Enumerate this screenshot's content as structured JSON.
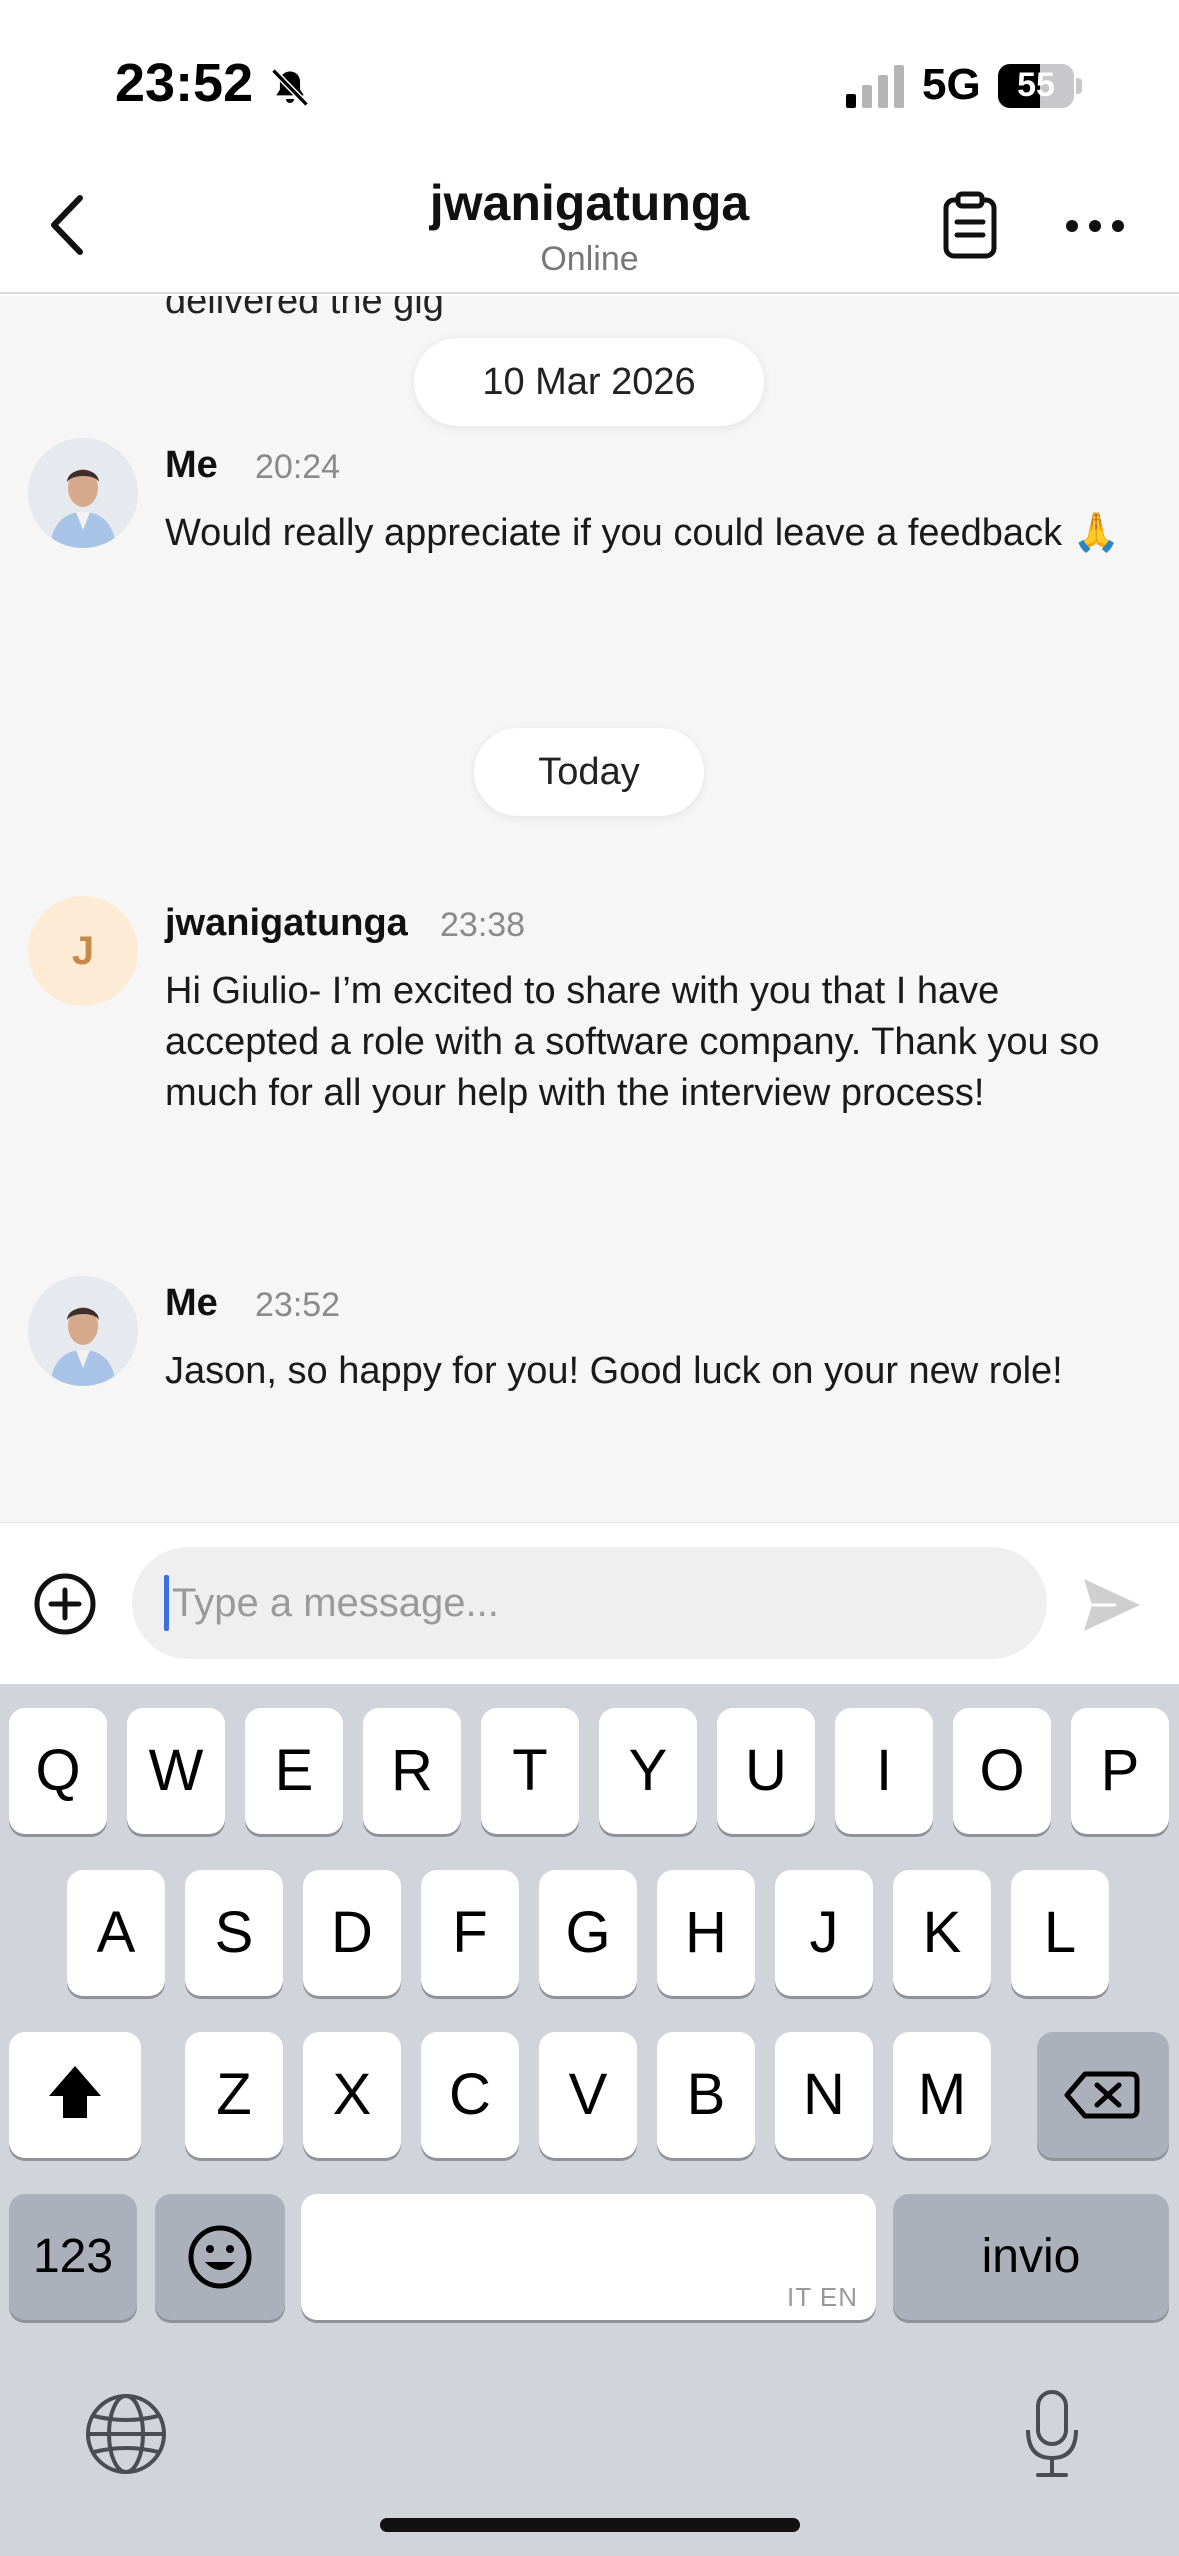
{
  "status_bar": {
    "time": "23:52",
    "network": "5G",
    "battery": "55",
    "battery_level": 0.55,
    "icons": [
      "bell-slash-icon",
      "signal-icon",
      "battery-icon"
    ]
  },
  "header": {
    "title": "jwanigatunga",
    "subtitle": "Online",
    "icons": [
      "back-chevron-icon",
      "clipboard-icon",
      "more-icon"
    ]
  },
  "chat": {
    "clipped_text": "delivered the gig",
    "dates": [
      "10 Mar 2026",
      "Today"
    ],
    "messages": [
      {
        "sender": "Me",
        "time": "20:24",
        "text": "Would really appreciate if you could leave a feedback 🙏",
        "avatar": "photo"
      },
      {
        "sender": "jwanigatunga",
        "time": "23:38",
        "text": "Hi Giulio- I’m excited to share with you that I have accepted a role with a software company. Thank you so much for all your help with the interview process!",
        "avatar": "J"
      },
      {
        "sender": "Me",
        "time": "23:52",
        "text": "Jason, so happy for you! Good luck on your new role!",
        "avatar": "photo"
      }
    ]
  },
  "composer": {
    "placeholder": "Type a message...",
    "value": "",
    "icons": [
      "plus-circle-icon",
      "send-icon"
    ]
  },
  "keyboard": {
    "row1": [
      "Q",
      "W",
      "E",
      "R",
      "T",
      "Y",
      "U",
      "I",
      "O",
      "P"
    ],
    "row2": [
      "A",
      "S",
      "D",
      "F",
      "G",
      "H",
      "J",
      "K",
      "L"
    ],
    "row3": [
      "Z",
      "X",
      "C",
      "V",
      "B",
      "N",
      "M"
    ],
    "numbers_label": "123",
    "space_hint": "IT EN",
    "return_label": "invio",
    "icons": [
      "shift-icon",
      "backspace-icon",
      "emoji-icon",
      "globe-icon",
      "microphone-icon"
    ]
  },
  "colors": {
    "caret": "#3b6fe0",
    "avatar_letter_bg": "#fdebd6",
    "keyboard_bg": "#d1d4db"
  }
}
